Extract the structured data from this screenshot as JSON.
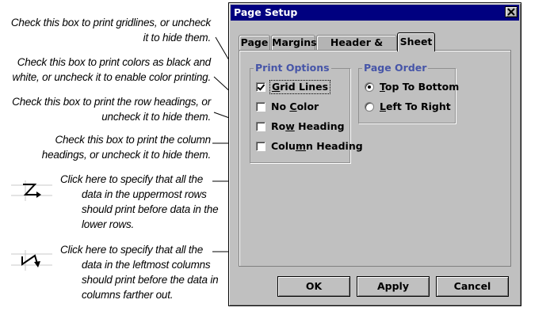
{
  "callouts": {
    "gridlines": [
      "Check this box to print gridlines, or uncheck",
      "it to hide them."
    ],
    "color": [
      "Check this box to print colors as black and",
      "white, or uncheck it to enable color printing."
    ],
    "row_heading": [
      "Check this box to print the row headings, or",
      "uncheck it to hide them."
    ],
    "column_heading": [
      "Check this box to print the column",
      "headings, or uncheck it to hide them."
    ],
    "top_to_bottom": [
      "Click here to specify that all the",
      "data in the uppermost rows",
      "should print before data in the",
      "lower rows."
    ],
    "left_to_right": [
      "Click here to specify that all the",
      "data in the leftmost columns",
      "should print before the data in",
      "columns farther out."
    ]
  },
  "dialog": {
    "title": "Page Setup",
    "close_glyph": "✕",
    "tabs": [
      "Page",
      "Margins",
      "Header & Footer",
      "Sheet"
    ],
    "active_tab": "Sheet",
    "print_options": {
      "label": "Print Options",
      "items": [
        {
          "pre": "",
          "ul": "G",
          "post": "rid Lines",
          "checked": true
        },
        {
          "pre": "No ",
          "ul": "C",
          "post": "olor",
          "checked": false
        },
        {
          "pre": "Ro",
          "ul": "w",
          "post": " Heading",
          "checked": false
        },
        {
          "pre": "Colu",
          "ul": "m",
          "post": "n Heading",
          "checked": false
        }
      ]
    },
    "page_order": {
      "label": "Page Order",
      "items": [
        {
          "pre": "",
          "ul": "T",
          "post": "op To Bottom",
          "selected": true
        },
        {
          "pre": "",
          "ul": "L",
          "post": "eft To Right",
          "selected": false
        }
      ]
    },
    "buttons": {
      "ok": "OK",
      "apply": "Apply",
      "cancel": "Cancel"
    }
  }
}
